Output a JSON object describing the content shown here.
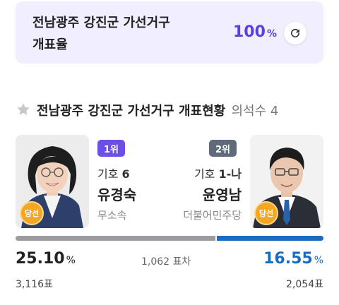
{
  "header_card": {
    "title_line1": "전남광주 강진군 가선거구",
    "title_line2": "개표율",
    "percent_value": "100",
    "percent_unit": "%",
    "refresh_icon": "refresh-icon"
  },
  "section": {
    "icon": "star-icon",
    "title": "전남광주 강진군 가선거구 개표현황",
    "seats": "의석수 4"
  },
  "candidates": [
    {
      "rank": "1위",
      "number_label": "기호",
      "number": "6",
      "name": "유경숙",
      "party": "무소속",
      "won_badge": "당선",
      "percent": "25.10",
      "percent_unit": "%",
      "votes": "3,116표",
      "rank_color": "#6d4fe8"
    },
    {
      "rank": "2위",
      "number_label": "기호",
      "number": "1-나",
      "name": "윤영남",
      "party": "더불어민주당",
      "won_badge": "당선",
      "percent": "16.55",
      "percent_unit": "%",
      "votes": "2,054표",
      "rank_color": "#5f6b7a",
      "percent_color": "#1a6cc0"
    }
  ],
  "difference": "1,062 표차",
  "colors": {
    "card_bg": "#f1efff",
    "accent_purple": "#5b3fe0",
    "bar_gray": "#9b9ba0",
    "bar_blue": "#1a6cc0",
    "won_badge": "#f5a623"
  }
}
